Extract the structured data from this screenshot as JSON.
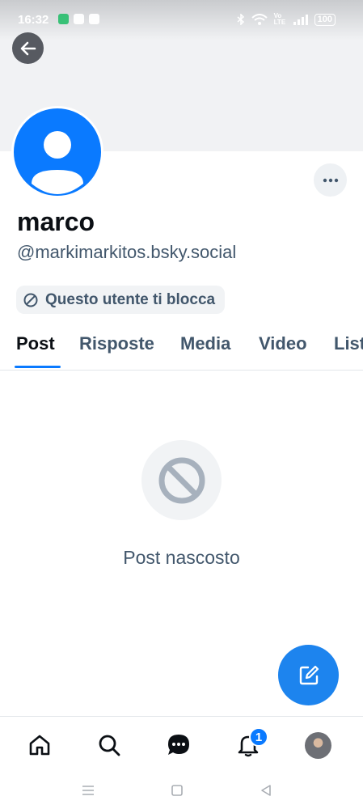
{
  "status_bar": {
    "time": "16:32",
    "network": "Vo LTE",
    "battery": "100"
  },
  "profile": {
    "display_name": "marco",
    "handle": "@markimarkitos.bsky.social",
    "block_notice": "Questo utente ti blocca",
    "avatar_color": "#0a7aff"
  },
  "tabs": [
    "Post",
    "Risposte",
    "Media",
    "Video",
    "Liste"
  ],
  "active_tab": "Post",
  "empty_state": {
    "label": "Post nascosto",
    "icon": "blocked-icon"
  },
  "bottom_nav": {
    "items": [
      "home-icon",
      "search-icon",
      "chat-icon",
      "bell-icon",
      "profile-avatar"
    ],
    "notification_count": "1"
  },
  "colors": {
    "accent": "#0a7aff",
    "fab": "#1d84ee",
    "muted_text": "#42576c"
  }
}
